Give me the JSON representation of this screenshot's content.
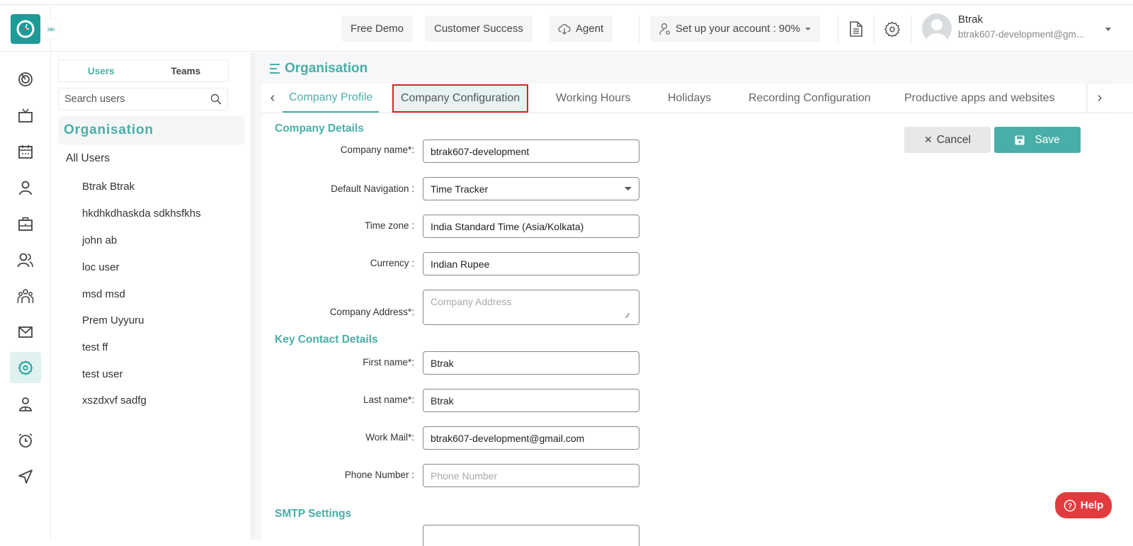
{
  "topbar": {
    "expand_icon": "»»",
    "free_demo": "Free Demo",
    "customer_success": "Customer Success",
    "agent": "Agent",
    "setup_account": "Set up your account : 90%",
    "setup_progress_percent": 90,
    "user": {
      "name": "Btrak",
      "email": "btrak607-development@gm..."
    }
  },
  "rail": {
    "items": [
      {
        "icon": "dashboard-icon"
      },
      {
        "icon": "tv-icon"
      },
      {
        "icon": "calendar-icon"
      },
      {
        "icon": "user-icon"
      },
      {
        "icon": "briefcase-icon"
      },
      {
        "icon": "users-icon"
      },
      {
        "icon": "team-icon"
      },
      {
        "icon": "mail-icon"
      },
      {
        "icon": "settings-icon",
        "active": true
      },
      {
        "icon": "person-badge-icon"
      },
      {
        "icon": "alarm-icon"
      },
      {
        "icon": "send-icon"
      }
    ]
  },
  "users_panel": {
    "tabs": [
      {
        "label": "Users",
        "active": true
      },
      {
        "label": "Teams",
        "active": false
      }
    ],
    "search_placeholder": "Search users",
    "org_heading": "Organisation",
    "all_users": "All Users",
    "users": [
      "Btrak Btrak",
      "hkdhkdhaskda sdkhsfkhs",
      "john ab",
      "loc user",
      "msd msd",
      "Prem Uyyuru",
      "test ff",
      "test user",
      "xszdxvf sadfg"
    ]
  },
  "main": {
    "title": "Organisation",
    "tabs": [
      {
        "label": "Company Profile",
        "active": true
      },
      {
        "label": "Company Configuration",
        "highlighted": true
      },
      {
        "label": "Working Hours"
      },
      {
        "label": "Holidays"
      },
      {
        "label": "Recording Configuration"
      },
      {
        "label": "Productive apps and websites"
      }
    ],
    "buttons": {
      "cancel": "Cancel",
      "save": "Save"
    },
    "company_details": {
      "title": "Company Details",
      "company_name_label": "Company name*:",
      "company_name": "btrak607-development",
      "default_navigation_label": "Default Navigation :",
      "default_navigation": "Time Tracker",
      "time_zone_label": "Time zone :",
      "time_zone": "India Standard Time (Asia/Kolkata)",
      "currency_label": "Currency :",
      "currency": "Indian Rupee",
      "address_label": "Company Address*:",
      "address_placeholder": "Company Address"
    },
    "key_contact": {
      "title": "Key Contact Details",
      "first_name_label": "First name*:",
      "first_name": "Btrak",
      "last_name_label": "Last name*:",
      "last_name": "Btrak",
      "work_mail_label": "Work Mail*:",
      "work_mail": "btrak607-development@gmail.com",
      "phone_label": "Phone Number :",
      "phone_placeholder": "Phone Number"
    },
    "smtp": {
      "title": "SMTP Settings"
    }
  },
  "help": {
    "label": "Help"
  },
  "colors": {
    "accent": "#4aaea8",
    "logo": "#1e9b98",
    "highlight_border": "#e01f1f",
    "help": "#e23b3f"
  }
}
